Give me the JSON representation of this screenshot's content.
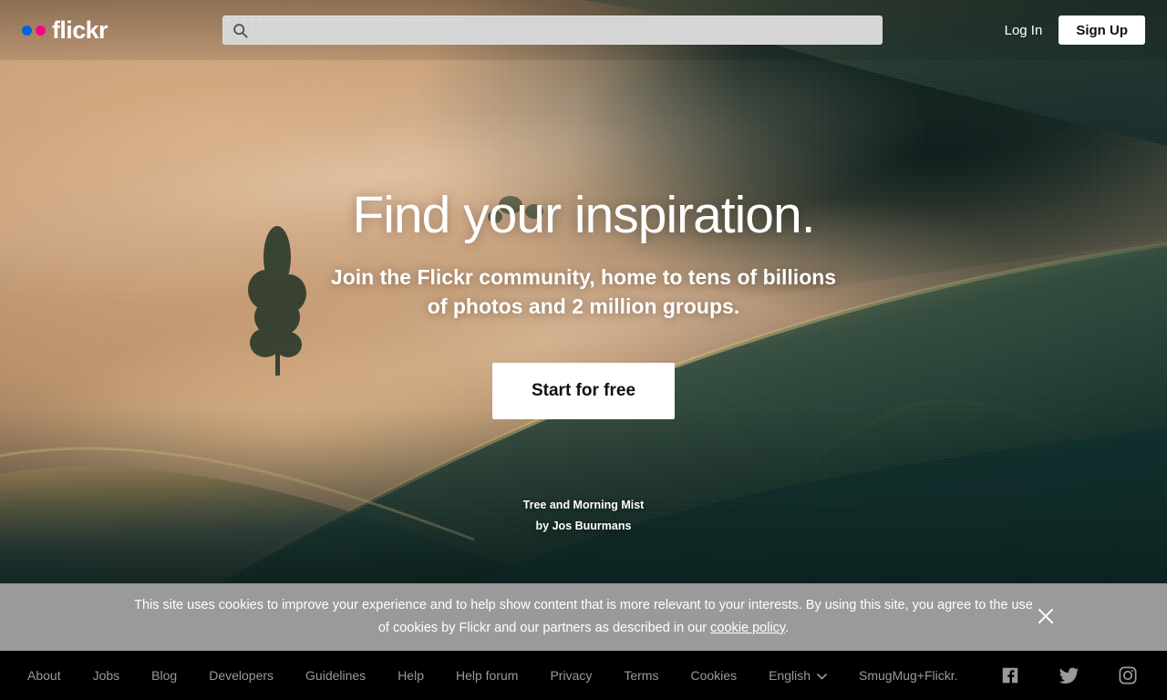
{
  "header": {
    "logo_word": "flickr",
    "logo_dot_blue": "#0063DB",
    "logo_dot_pink": "#FF0084",
    "search": {
      "value": "",
      "placeholder": "",
      "icon": "search-icon"
    },
    "login_label": "Log In",
    "signup_label": "Sign Up"
  },
  "hero": {
    "headline": "Find your inspiration.",
    "subhead_line1": "Join the Flickr community, home to tens of billions",
    "subhead_line2": "of photos and 2 million groups.",
    "cta_label": "Start for free",
    "photo_title": "Tree and Morning Mist",
    "photo_credit": "by Jos Buurmans"
  },
  "cookie_banner": {
    "text_before_link": "This site uses cookies to improve your experience and to help show content that is more relevant to your interests. By using this site, you agree to the use of cookies by Flickr and our partners as described in our ",
    "link_label": "cookie policy",
    "text_after_link": ".",
    "close_icon": "close-icon",
    "background": "#9a9a9a"
  },
  "footer": {
    "links": [
      {
        "label": "About"
      },
      {
        "label": "Jobs"
      },
      {
        "label": "Blog"
      },
      {
        "label": "Developers"
      },
      {
        "label": "Guidelines"
      },
      {
        "label": "Help"
      },
      {
        "label": "Help forum"
      },
      {
        "label": "Privacy"
      },
      {
        "label": "Terms"
      },
      {
        "label": "Cookies"
      }
    ],
    "language": "English",
    "smugmug_label": "SmugMug+Flickr.",
    "social": [
      {
        "name": "facebook-icon"
      },
      {
        "name": "twitter-icon"
      },
      {
        "name": "instagram-icon"
      }
    ]
  }
}
